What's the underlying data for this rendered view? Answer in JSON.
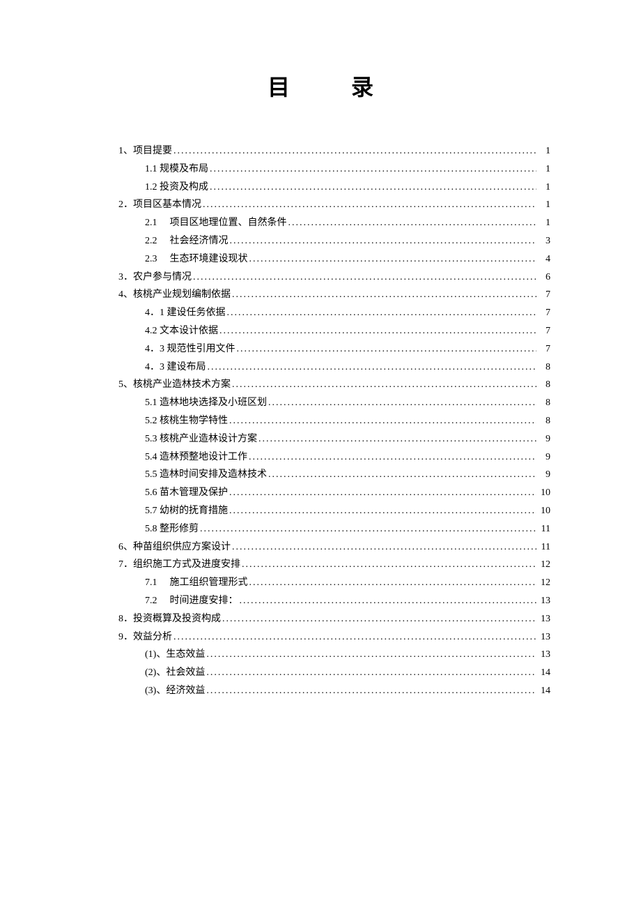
{
  "title": "目 录",
  "toc": [
    {
      "level": 1,
      "label": "1、项目提要",
      "page": "1"
    },
    {
      "level": 2,
      "label": "1.1 规模及布局",
      "page": "1"
    },
    {
      "level": 2,
      "label": "1.2 投资及构成",
      "page": "1"
    },
    {
      "level": 1,
      "label": "2．项目区基本情况",
      "page": "1"
    },
    {
      "level": 2,
      "num": "2.1",
      "text": "项目区地理位置、自然条件",
      "page": "1"
    },
    {
      "level": 2,
      "num": "2.2",
      "text": "社会经济情况",
      "page": "3"
    },
    {
      "level": 2,
      "num": "2.3",
      "text": "生态环境建设现状",
      "page": "4"
    },
    {
      "level": 1,
      "label": "3．农户参与情况",
      "page": "6"
    },
    {
      "level": 1,
      "label": "4、核桃产业规划编制依据",
      "page": "7"
    },
    {
      "level": 2,
      "label": "4．1 建设任务依据",
      "page": "7"
    },
    {
      "level": 2,
      "label": "4.2 文本设计依据",
      "page": "7"
    },
    {
      "level": 2,
      "label": "4．3 规范性引用文件",
      "page": "7"
    },
    {
      "level": 2,
      "label": "4．3 建设布局",
      "page": "8"
    },
    {
      "level": 1,
      "label": "5、核桃产业造林技术方案",
      "page": "8"
    },
    {
      "level": 2,
      "label": "5.1 造林地块选择及小班区划",
      "page": "8"
    },
    {
      "level": 2,
      "label": "5.2 核桃生物学特性",
      "page": "8"
    },
    {
      "level": 2,
      "label": "5.3 核桃产业造林设计方案",
      "page": "9"
    },
    {
      "level": 2,
      "label": "5.4 造林预整地设计工作",
      "page": "9"
    },
    {
      "level": 2,
      "label": "5.5 造林时间安排及造林技术",
      "page": "9"
    },
    {
      "level": 2,
      "label": "5.6 苗木管理及保护",
      "page": "10"
    },
    {
      "level": 2,
      "label": "5.7 幼树的抚育措施",
      "page": "10"
    },
    {
      "level": 2,
      "label": "5.8 整形修剪",
      "page": "11"
    },
    {
      "level": 1,
      "label": "6、种苗组织供应方案设计",
      "page": "11"
    },
    {
      "level": 1,
      "label": "7．组织施工方式及进度安排",
      "page": "12"
    },
    {
      "level": 2,
      "num": "7.1",
      "text": "施工组织管理形式",
      "page": "12"
    },
    {
      "level": 2,
      "num": "7.2",
      "text": "时间进度安排：",
      "page": "13"
    },
    {
      "level": 1,
      "label": "8．投资概算及投资构成",
      "page": "13"
    },
    {
      "level": 1,
      "label": "9．效益分析",
      "page": "13"
    },
    {
      "level": 2,
      "label": "(1)、生态效益",
      "page": "13"
    },
    {
      "level": 2,
      "label": "(2)、社会效益",
      "page": "14"
    },
    {
      "level": 2,
      "label": "(3)、经济效益",
      "page": "14"
    }
  ]
}
